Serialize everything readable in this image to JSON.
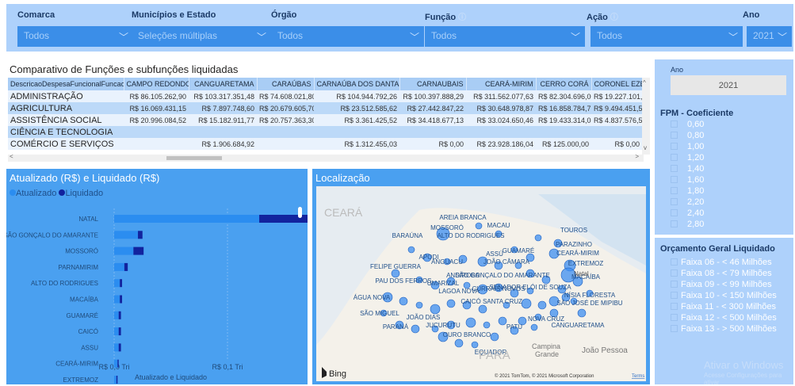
{
  "filters": [
    {
      "label": "Comarca",
      "value": "Todos",
      "info": false
    },
    {
      "label": "Municípios e Estado",
      "value": "Seleções múltiplas",
      "info": false
    },
    {
      "label": "Órgão",
      "value": "Todos",
      "info": false
    },
    {
      "label": "Função",
      "value": "Todos",
      "info": true
    },
    {
      "label": "Ação",
      "value": "Todos",
      "info": true
    },
    {
      "label": "Ano",
      "value": "2021",
      "info": false
    }
  ],
  "table": {
    "title": "Comparativo de Funções e subfunções liquidadas",
    "columns": [
      "DescricaoDespesaFuncionalFuncao",
      "CAMPO REDONDO",
      "CANGUARETAMA",
      "CARAÚBAS",
      "CARNAÚBA DOS DANTAS",
      "CARNAUBAIS",
      "CEARÁ-MIRIM",
      "CERRO CORÁ",
      "CORONEL EZEQUIEL"
    ],
    "rows": [
      [
        "ADMINISTRAÇÃO",
        "R$ 86.105.262,90",
        "R$ 103.317.351,48",
        "R$ 74.608.021,80",
        "R$ 104.944.792,26",
        "R$ 100.397.888,29",
        "R$ 311.562.077,63",
        "R$ 82.304.696,00",
        "R$ 19.227.101,30"
      ],
      [
        "AGRICULTURA",
        "R$ 16.069.431,15",
        "R$ 7.897.748,60",
        "R$ 20.679.605,70",
        "R$ 23.512.585,62",
        "R$ 27.442.847,22",
        "R$ 30.648.978,87",
        "R$ 16.858.784,75",
        "R$ 9.494.451,57"
      ],
      [
        "ASSISTÊNCIA SOCIAL",
        "R$ 20.996.084,52",
        "R$ 15.182.911,77",
        "R$ 20.757.363,30",
        "R$ 3.361.425,52",
        "R$ 34.418.677,13",
        "R$ 33.024.650,46",
        "R$ 19.433.314,08",
        "R$ 4.837.576,51"
      ],
      [
        "CIÊNCIA E TECNOLOGIA",
        "",
        "",
        "",
        "",
        "",
        "",
        "",
        ""
      ],
      [
        "COMÉRCIO E SERVIÇOS",
        "",
        "R$ 1.906.684,92",
        "",
        "R$ 1.312.455,03",
        "R$ 0,00",
        "R$ 23.928.186,04",
        "R$ 125.000,00",
        "R$ 0,00"
      ]
    ]
  },
  "barchart": {
    "title": "Atualizado (R$) e Liquidado (R$)",
    "legend": [
      "Atualizado",
      "Liquidado"
    ],
    "colors": {
      "atualizado": "#2b8df0",
      "liquidado": "#12239e"
    },
    "xlabel": "Atualizado e Liquidado",
    "ticks": [
      "R$ 0,0 Tri",
      "R$ 0,1 Tri"
    ]
  },
  "chart_data": {
    "type": "bar",
    "orientation": "horizontal",
    "title": "Atualizado (R$) e Liquidado (R$)",
    "xlabel": "Atualizado e Liquidado",
    "ylabel": "",
    "xlim": [
      0,
      0.2
    ],
    "unit": "R$ Tri",
    "categories": [
      "NATAL",
      "SÃO GONÇALO DO AMARANTE",
      "MOSSORÓ",
      "PARNAMIRIM",
      "ALTO DO RODRIGUES",
      "MACAÍBA",
      "GUAMARÉ",
      "CAICÓ",
      "ASSU",
      "CEARÁ-MIRIM",
      "EXTREMOZ"
    ],
    "stacked": true,
    "series": [
      {
        "name": "Atualizado",
        "values": [
          0.128,
          0.021,
          0.017,
          0.009,
          0.005,
          0.005,
          0.004,
          0.004,
          0.004,
          0.003,
          0.002
        ]
      },
      {
        "name": "Liquidado",
        "values": [
          0.053,
          0.004,
          0.009,
          0.003,
          0.002,
          0.002,
          0.002,
          0.002,
          0.002,
          0.001,
          0.001
        ]
      }
    ]
  },
  "map": {
    "title": "Localização",
    "region_labels": [
      "CEARÁ",
      "PARA",
      "Campina",
      "Grande",
      "João Pessoa",
      "Natal"
    ],
    "cities": [
      "AREIA BRANCA",
      "MOSSORÓ",
      "MACAU",
      "TOUROS",
      "BARAÚNA",
      "ALTO DO RODRIGUES",
      "GUAMARÉ",
      "ASSÚ",
      "PARAZINHO",
      "CEARÁ-MIRIM",
      "APODI",
      "ANGUACU",
      "JOÃO CÂMARA",
      "FELIPE GUERRA",
      "EXTREMOZ",
      "MACAÍBA",
      "PAU DOS FERROS",
      "SÃO GONÇALO DO AMARANTE",
      "ANDIROBA",
      "UMARIZAL",
      "CURRAIS NOVOS",
      "LAGOA NOVA",
      "SENADOR ELÓI DE SOUZA",
      "SÃO JOSÉ DE MIPIBU",
      "NÍSIA FLORESTA",
      "ÁGUA NOVA",
      "CAICÓ",
      "SANTA CRUZ",
      "SÃO MIGUEL",
      "JOÃO DIAS",
      "NOVA CRUZ",
      "CANGUARETAMA",
      "PARANÁ",
      "JUCURUTU",
      "OURO BRANCO",
      "EQUADOR",
      "PATU"
    ],
    "attribution": "© 2021 TomTom, © 2021 Microsoft Corporation",
    "terms": "Terms",
    "bing": "Bing"
  },
  "ano": {
    "label": "Ano",
    "value": "2021"
  },
  "fpm": {
    "title": "FPM - Coeficiente",
    "options": [
      "0,60",
      "0,80",
      "1,00",
      "1,20",
      "1,40",
      "1,60",
      "1,80",
      "2,20",
      "2,40",
      "2,80"
    ]
  },
  "orcamento": {
    "title": "Orçamento Geral Liquidado",
    "options": [
      "Faixa 06 - < 46 Milhões",
      "Faixa 08 - < 79 Milhões",
      "Faixa 09 - < 99 Milhões",
      "Faixa 10 - < 150 Milhões",
      "Faixa 11 - < 300 Milhões",
      "Faixa 12 - < 500 Milhões",
      "Faixa 13 - > 500 Milhões"
    ]
  },
  "watermark": {
    "line1": "Ativar o Windows",
    "line2": "Acesse Configurações para ativar"
  }
}
